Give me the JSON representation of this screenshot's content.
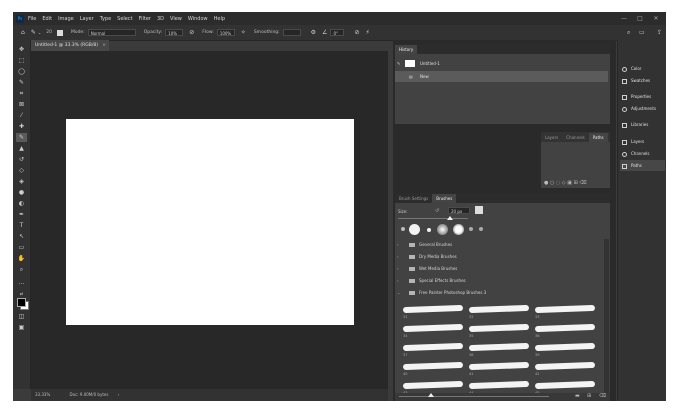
{
  "app": {
    "logo": "Ps",
    "menu": [
      "File",
      "Edit",
      "Image",
      "Layer",
      "Type",
      "Select",
      "Filter",
      "3D",
      "View",
      "Window",
      "Help"
    ]
  },
  "window_controls": {
    "minimize": "—",
    "restore": "□",
    "close": "✕"
  },
  "options_bar": {
    "brush_size": "20",
    "mode_label": "Mode:",
    "mode_value": "Normal",
    "opacity_label": "Opacity:",
    "opacity_value": "10%",
    "flow_label": "Flow:",
    "flow_value": "100%",
    "smoothing_label": "Smoothing:",
    "angle_value": "0°"
  },
  "document": {
    "tab_title": "Untitled-1 @ 33.3% (RGB/8)",
    "zoom": "33.33%",
    "doc_info": "Doc: 9.00M/0 bytes"
  },
  "history": {
    "tab": "History",
    "snapshot_label": "Untitled-1",
    "state_label": "New"
  },
  "layers_group": {
    "tabs": [
      "Layers",
      "Channels",
      "Paths"
    ]
  },
  "brushes": {
    "tabs": [
      "Brush Settings",
      "Brushes"
    ],
    "size_label": "Size:",
    "size_value": "20 px",
    "groups": [
      "General Brushes",
      "Dry Media Brushes",
      "Wet Media Brushes",
      "Special Effects Brushes",
      "Free Painter Photoshop Brushes 3"
    ],
    "strokes": [
      "31",
      "32",
      "33",
      "34",
      "35",
      "36",
      "37",
      "38",
      "39",
      "40",
      "41",
      "42",
      "43",
      "44",
      "45"
    ]
  },
  "right_panels": [
    "Color",
    "Swatches",
    "Properties",
    "Adjustments",
    "Libraries",
    "Layers",
    "Channels",
    "Paths"
  ],
  "colors": {
    "accent": "#31a8ff",
    "canvas": "#ffffff",
    "pasteboard": "#282828"
  }
}
